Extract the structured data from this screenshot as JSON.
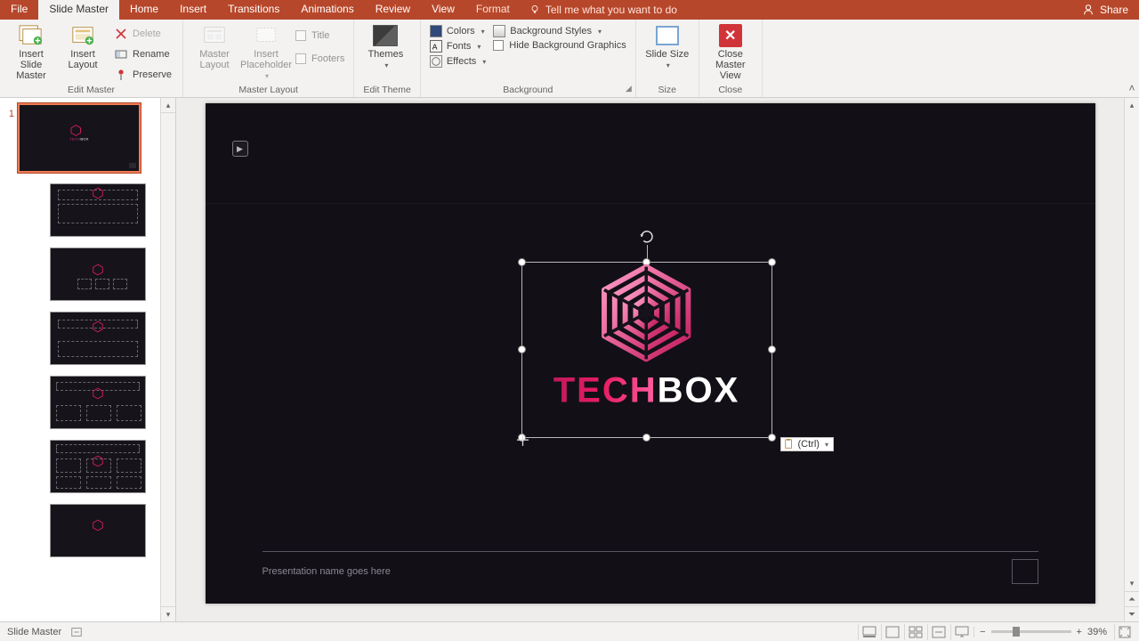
{
  "tabs": {
    "file": "File",
    "slide_master": "Slide Master",
    "home": "Home",
    "insert": "Insert",
    "transitions": "Transitions",
    "animations": "Animations",
    "review": "Review",
    "view": "View",
    "format": "Format"
  },
  "tellme": "Tell me what you want to do",
  "share": "Share",
  "ribbon": {
    "edit_master": {
      "insert_slide_master": "Insert Slide Master",
      "insert_layout": "Insert Layout",
      "delete": "Delete",
      "rename": "Rename",
      "preserve": "Preserve",
      "label": "Edit Master"
    },
    "master_layout": {
      "master_layout": "Master Layout",
      "insert_placeholder": "Insert Placeholder",
      "title": "Title",
      "footers": "Footers",
      "label": "Master Layout"
    },
    "edit_theme": {
      "themes": "Themes",
      "label": "Edit Theme"
    },
    "background": {
      "colors": "Colors",
      "fonts": "Fonts",
      "effects": "Effects",
      "styles": "Background Styles",
      "hide": "Hide Background Graphics",
      "label": "Background"
    },
    "size": {
      "slide_size": "Slide Size",
      "label": "Size"
    },
    "close": {
      "close_master": "Close Master View",
      "label": "Close"
    }
  },
  "thumbs": {
    "master_num": "1"
  },
  "slide": {
    "logo_tech": "TECH",
    "logo_box": "BOX",
    "footer": "Presentation name goes here"
  },
  "paste_tag": "(Ctrl)",
  "status": {
    "mode": "Slide Master",
    "zoom": "39%"
  },
  "zoom_controls": {
    "minus": "−",
    "plus": "+"
  }
}
